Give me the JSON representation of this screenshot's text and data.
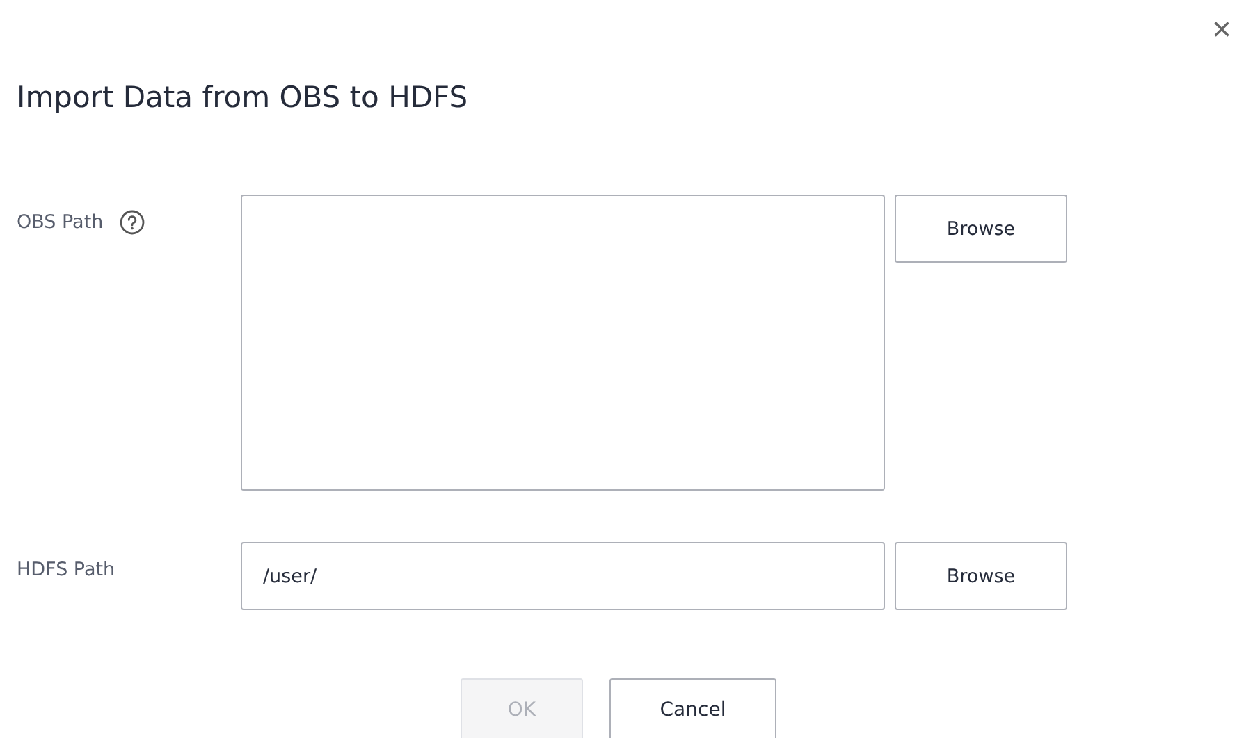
{
  "dialog": {
    "title": "Import Data from OBS to HDFS",
    "close": "×"
  },
  "fields": [
    {
      "kind": "textarea",
      "label": "OBS Path",
      "help": true,
      "button": "Browse"
    },
    {
      "kind": "input",
      "label": "HDFS Path",
      "help": false,
      "value": "/user/",
      "button": "Browse"
    }
  ],
  "actions": [
    {
      "label": "OK",
      "disabled": true
    },
    {
      "label": "Cancel",
      "disabled": false
    }
  ]
}
